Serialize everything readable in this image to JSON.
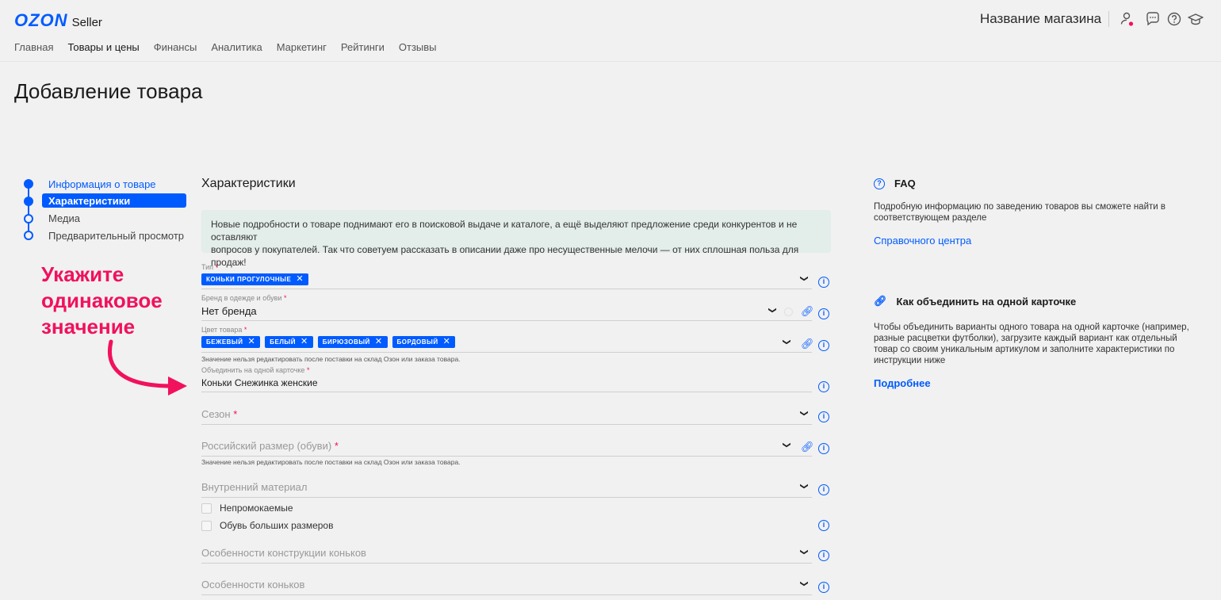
{
  "header": {
    "logo_main": "OZON",
    "logo_sub": "Seller",
    "store_name": "Название магазина",
    "nav": [
      "Главная",
      "Товары и цены",
      "Финансы",
      "Аналитика",
      "Маркетинг",
      "Рейтинги",
      "Отзывы"
    ],
    "active_nav": "Товары и цены",
    "icons": [
      "user-icon",
      "chat-icon",
      "help-icon",
      "education-icon"
    ]
  },
  "page_title": "Добавление товара",
  "steps": [
    "Информация о товаре",
    "Характеристики",
    "Медиа",
    "Предварительный просмотр"
  ],
  "callout": {
    "line1": "Укажите",
    "line2": "одинаковое",
    "line3": "значение"
  },
  "section_title": "Характеристики",
  "info_text_line1": "Новые подробности о товаре поднимают его в поисковой выдаче и каталоге, а ещё выделяют предложение среди конкурентов и не оставляют",
  "info_text_line2": "вопросов у покупателей. Так что советуем рассказать в описании даже про несущественные мелочи — от них сплошная польза для продаж!",
  "fields": {
    "type": {
      "label": "Тип",
      "tags": [
        "КОНЬКИ ПРОГУЛОЧНЫЕ"
      ]
    },
    "brand": {
      "label": "Бренд в одежде и обуви",
      "value": "Нет бренда"
    },
    "color": {
      "label": "Цвет товара",
      "tags": [
        "БЕЖЕВЫЙ",
        "БЕЛЫЙ",
        "БИРЮЗОВЫЙ",
        "БОРДОВЫЙ"
      ]
    },
    "note": "Значение нельзя редактировать после поставки на склад Озон или заказа товара.",
    "combine": {
      "label": "Объединить на одной карточке",
      "value": "Коньки Снежинка женские"
    },
    "season": {
      "placeholder": "Сезон"
    },
    "size": {
      "placeholder": "Российский размер (обуви)"
    },
    "inner_material": {
      "placeholder": "Внутренний материал"
    },
    "waterproof": "Непромокаемые",
    "big_sizes": "Обувь больших размеров",
    "construction": {
      "placeholder": "Особенности конструкции коньков"
    },
    "features": {
      "placeholder": "Особенности коньков"
    }
  },
  "required_mark": "*",
  "tag_remove": "✕",
  "sidebar": {
    "faq_title": "FAQ",
    "faq_text": "Подробную информацию по заведению товаров вы сможете найти в соответствующем разделе",
    "faq_link": "Справочного центра",
    "combine_title": "Как объединить на одной карточке",
    "combine_text": "Чтобы объединить варианты одного товара на одной карточке (например, разные расцветки футболки), загрузите каждый вариант как отдельный товар со своим уникальным артикулом и заполните характеристики по инструкции ниже",
    "more_link": "Подробнее"
  },
  "colors": {
    "accent": "#005bff",
    "callout": "#f1115c",
    "info_bg": "#e3edea"
  }
}
